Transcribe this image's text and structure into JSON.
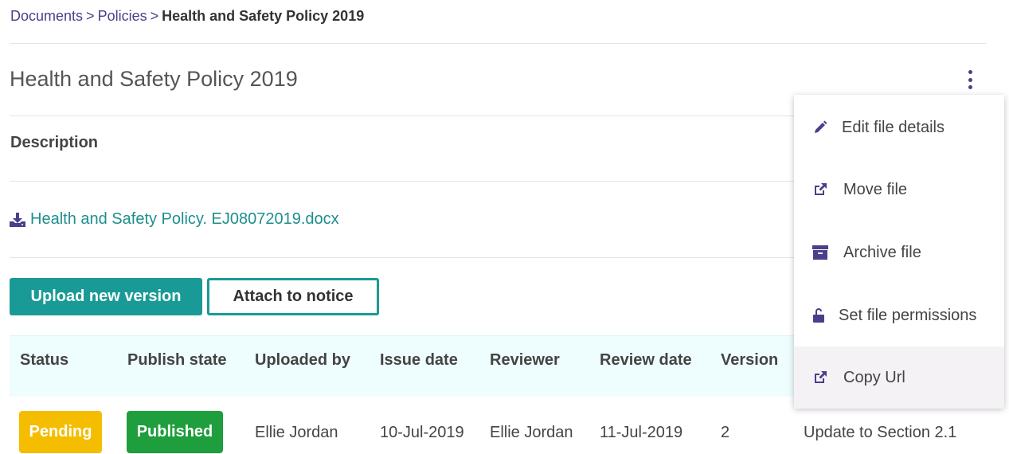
{
  "breadcrumb": {
    "items": [
      "Documents",
      "Policies"
    ],
    "separator": ">",
    "current": "Health and Safety Policy 2019"
  },
  "page": {
    "title": "Health and Safety Policy 2019",
    "description_label": "Description",
    "file_name": "Health and Safety Policy. EJ08072019.docx"
  },
  "actions": {
    "upload_label": "Upload new version",
    "attach_label": "Attach to notice"
  },
  "table": {
    "headers": [
      "Status",
      "Publish state",
      "Uploaded by",
      "Issue date",
      "Reviewer",
      "Review date",
      "Version"
    ],
    "row": {
      "status": "Pending",
      "publish_state": "Published",
      "uploaded_by": "Ellie Jordan",
      "issue_date": "10-Jul-2019",
      "reviewer": "Ellie Jordan",
      "review_date": "11-Jul-2019",
      "version": "2",
      "comment": "Update to Section 2.1"
    }
  },
  "menu": {
    "items": [
      {
        "label": "Edit file details",
        "icon": "pencil-icon"
      },
      {
        "label": "Move file",
        "icon": "external-link-icon"
      },
      {
        "label": "Archive file",
        "icon": "archive-icon"
      },
      {
        "label": "Set file permissions",
        "icon": "unlock-icon"
      },
      {
        "label": "Copy Url",
        "icon": "external-link-icon"
      }
    ]
  },
  "colors": {
    "accent": "#1a9a96",
    "brand_purple": "#4a3f8a",
    "link": "#1e8e8e",
    "pending": "#f5bd00",
    "published": "#1e9e3c"
  }
}
